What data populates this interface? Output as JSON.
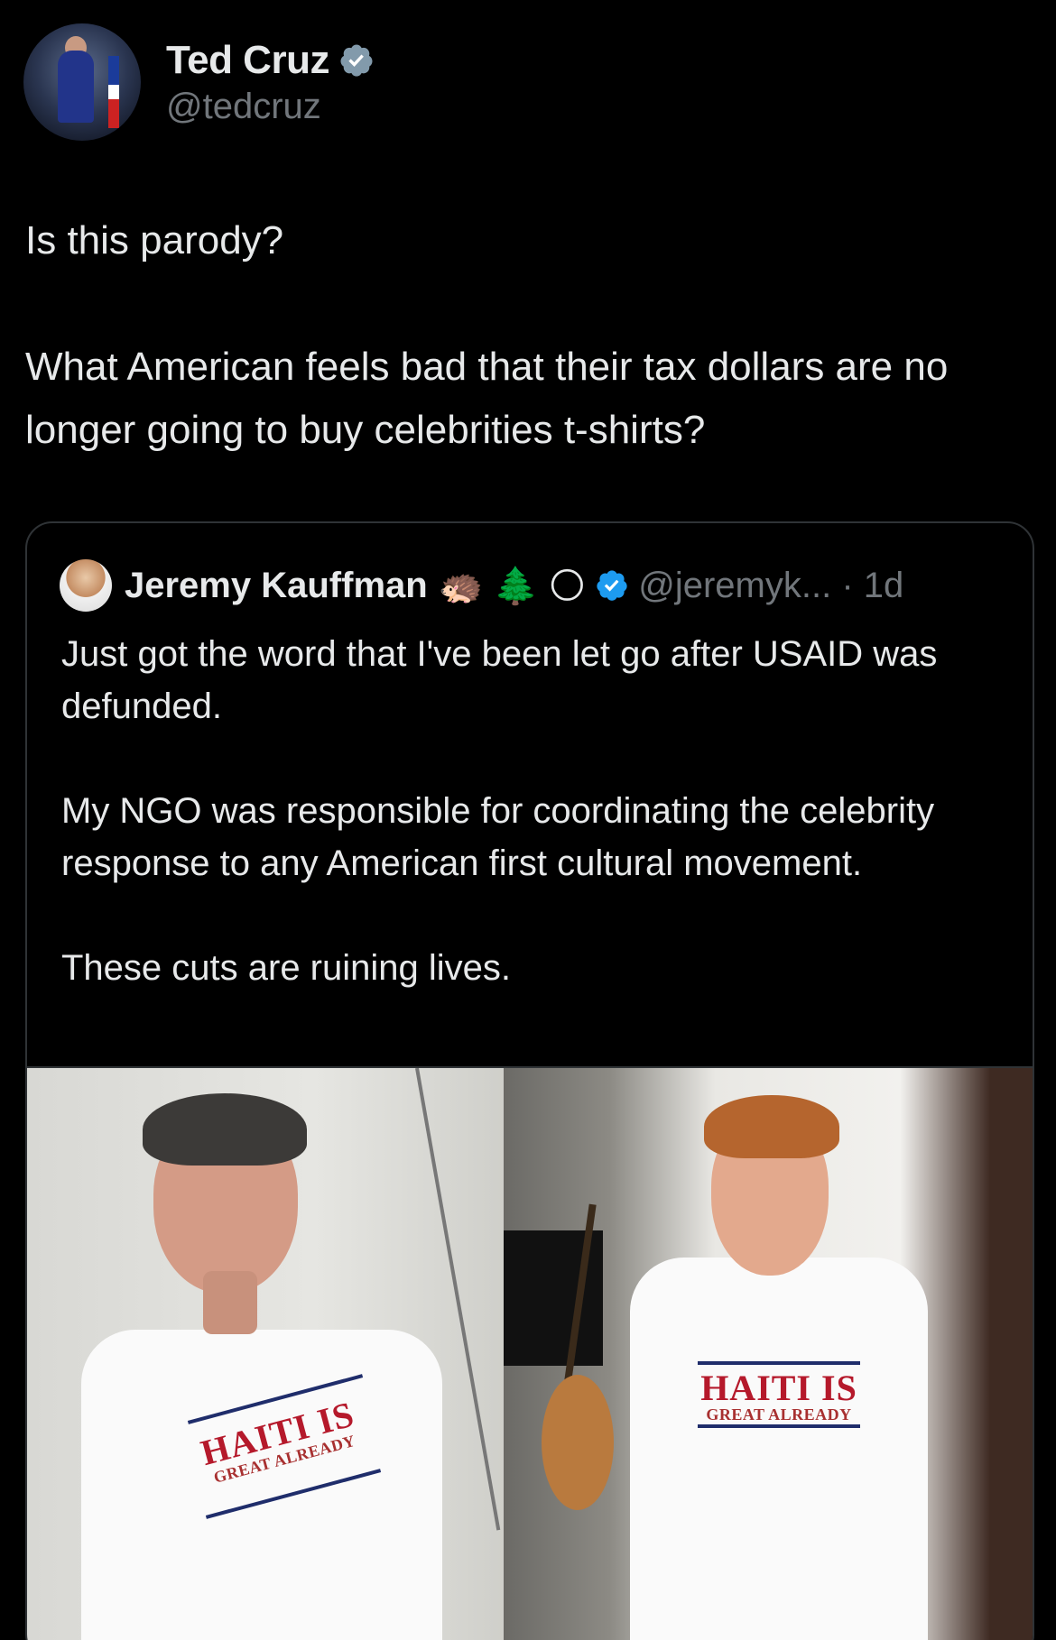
{
  "author": {
    "display_name": "Ted Cruz",
    "handle": "@tedcruz",
    "verified_icon": "verified-badge-icon"
  },
  "tweet": {
    "line1": "Is this parody?",
    "line2": "What American feels bad that their tax dollars are no longer going to buy celebrities t-shirts?"
  },
  "quoted": {
    "display_name": "Jeremy Kauffman",
    "emojis": "🦔 🌲 🌕",
    "handle_time": "@jeremyk... · 1d",
    "paragraphs": [
      "Just got the word that I've been let go after USAID was defunded.",
      "My NGO was responsible for coordinating the celebrity response to any American first cultural movement.",
      "These cuts are ruining lives."
    ],
    "image": {
      "left_shirt_line1": "HAITI IS",
      "left_shirt_line2": "GREAT ALREADY",
      "right_shirt_line1": "HAITI IS",
      "right_shirt_line2": "GREAT ALREADY"
    }
  },
  "colors": {
    "background": "#000000",
    "text": "#e7e9ea",
    "secondary": "#71767b",
    "border": "#2f3336",
    "verified_blue": "#1d9bf0",
    "verified_gray": "#829aab"
  }
}
